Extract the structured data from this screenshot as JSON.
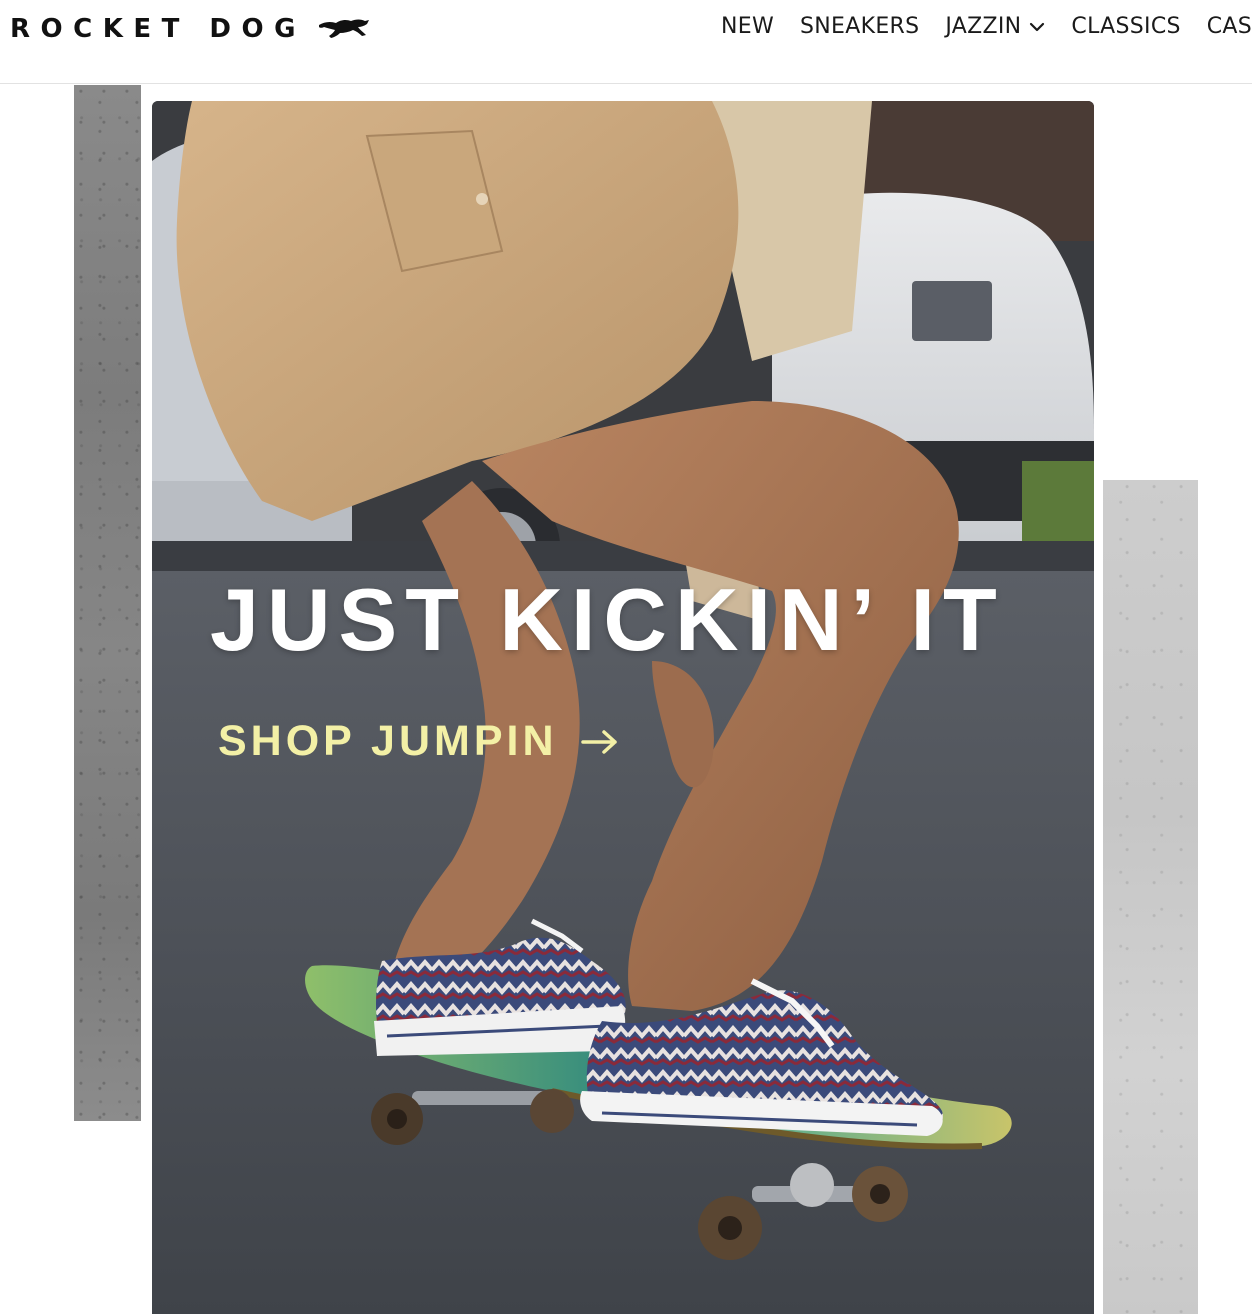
{
  "brand": {
    "logo_text": "ROCKET DOG",
    "logo_icon": "running-dog-icon"
  },
  "nav": {
    "items": [
      {
        "label": "NEW"
      },
      {
        "label": "SNEAKERS"
      },
      {
        "label": "JAZZIN",
        "has_dropdown": true,
        "dropdown_icon": "chevron-down-icon"
      },
      {
        "label": "CLASSICS"
      },
      {
        "label": "CASU"
      }
    ]
  },
  "hero": {
    "headline": "JUST KICKIN’ IT",
    "cta_label": "SHOP JUMPIN",
    "cta_icon": "arrow-right-icon"
  },
  "colors": {
    "headline": "#ffffff",
    "cta": "#f3f0a6",
    "text": "#1a1a1a"
  }
}
